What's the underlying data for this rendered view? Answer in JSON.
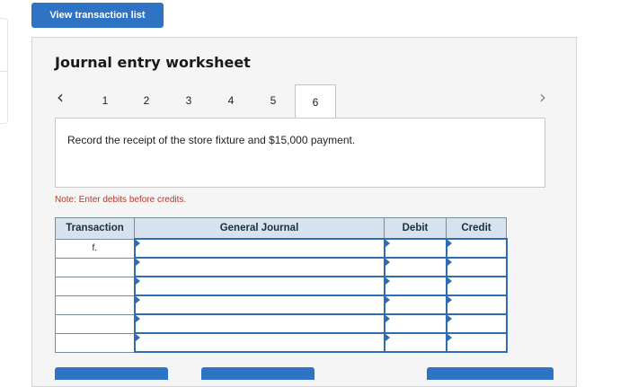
{
  "top_button": {
    "label": "View transaction list"
  },
  "worksheet": {
    "title": "Journal entry worksheet",
    "tabs": [
      {
        "label": "1",
        "active": false
      },
      {
        "label": "2",
        "active": false
      },
      {
        "label": "3",
        "active": false
      },
      {
        "label": "4",
        "active": false
      },
      {
        "label": "5",
        "active": false
      },
      {
        "label": "6",
        "active": true
      }
    ],
    "prompt": "Record the receipt of the store fixture and $15,000 payment.",
    "note": "Note: Enter debits before credits.",
    "table": {
      "headers": {
        "transaction": "Transaction",
        "journal": "General Journal",
        "debit": "Debit",
        "credit": "Credit"
      },
      "rows": [
        {
          "transaction": "f."
        },
        {
          "transaction": ""
        },
        {
          "transaction": ""
        },
        {
          "transaction": ""
        },
        {
          "transaction": ""
        },
        {
          "transaction": ""
        }
      ]
    }
  },
  "colors": {
    "button": "#2f74c4",
    "header_bg": "#d7e2ef",
    "input_border": "#2f6cb0",
    "note": "#b23a2e"
  },
  "icons": {
    "prev": "chevron-left-icon",
    "next": "chevron-right-icon"
  }
}
